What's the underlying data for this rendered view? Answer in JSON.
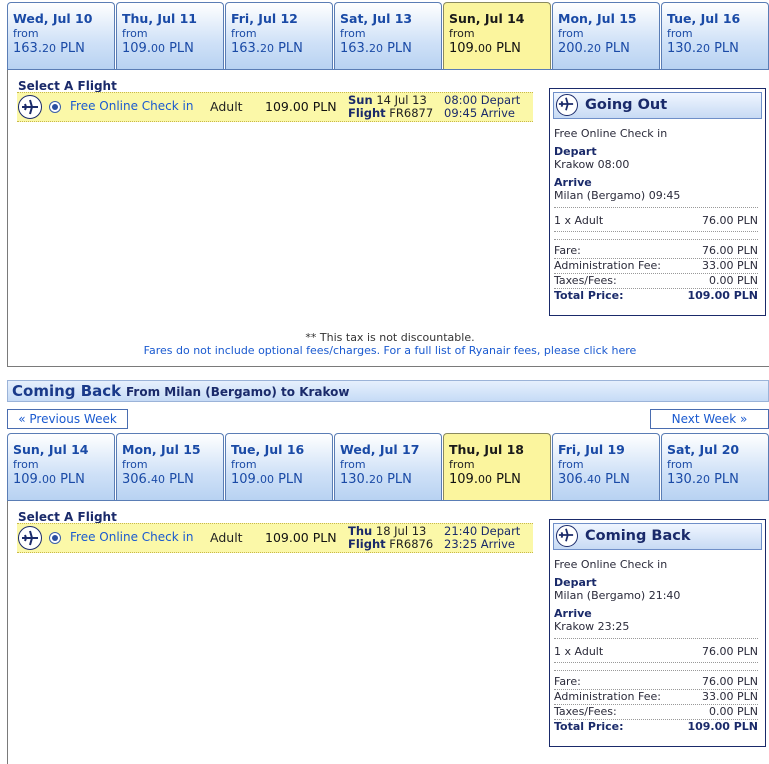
{
  "outbound": {
    "dates": [
      {
        "day": "Wed, Jul 10",
        "from": "from",
        "price_main": "163.",
        "price_dec": "20",
        "currency": " PLN"
      },
      {
        "day": "Thu, Jul 11",
        "from": "from",
        "price_main": "109.",
        "price_dec": "00",
        "currency": " PLN"
      },
      {
        "day": "Fri, Jul 12",
        "from": "from",
        "price_main": "163.",
        "price_dec": "20",
        "currency": " PLN"
      },
      {
        "day": "Sat, Jul 13",
        "from": "from",
        "price_main": "163.",
        "price_dec": "20",
        "currency": " PLN"
      },
      {
        "day": "Sun, Jul 14",
        "from": "from",
        "price_main": "109.",
        "price_dec": "00",
        "currency": " PLN"
      },
      {
        "day": "Mon, Jul 15",
        "from": "from",
        "price_main": "200.",
        "price_dec": "20",
        "currency": " PLN"
      },
      {
        "day": "Tue, Jul 16",
        "from": "from",
        "price_main": "130.",
        "price_dec": "20",
        "currency": " PLN"
      }
    ],
    "selected_index": 4,
    "select_title": "Select A Flight",
    "flight": {
      "checkin": "Free Online Check in",
      "passenger": "Adult",
      "price": "109.00 PLN",
      "date_day": "Sun",
      "date_rest": " 14 Jul 13",
      "flight_label": "Flight",
      "flight_no": " FR6877",
      "depart_time": "08:00 Depart",
      "arrive_time": "09:45 Arrive"
    },
    "summary": {
      "title": "Going Out",
      "checkin": "Free Online Check in",
      "depart_label": "Depart",
      "depart_value": "Krakow 08:00",
      "arrive_label": "Arrive",
      "arrive_value": "Milan (Bergamo) 09:45",
      "pax_label": "1 x Adult",
      "pax_value": "76.00 PLN",
      "fare_label": "Fare:",
      "fare_value": "76.00 PLN",
      "admin_label": "Administration Fee:",
      "admin_value": "33.00 PLN",
      "taxes_label": "Taxes/Fees:",
      "taxes_value": "0.00 PLN",
      "total_label": "Total Price:",
      "total_value": "109.00 PLN"
    },
    "note": "** This tax is not discountable.",
    "fees_link": "Fares do not include optional fees/charges. For a full list of Ryanair fees, please click here"
  },
  "coming_back_bar": {
    "title": "Coming Back",
    "subtitle": "From Milan (Bergamo) to Krakow"
  },
  "week_nav": {
    "prev": "« Previous Week",
    "next": "Next Week »"
  },
  "inbound": {
    "dates": [
      {
        "day": "Sun, Jul 14",
        "from": "from",
        "price_main": "109.",
        "price_dec": "00",
        "currency": " PLN"
      },
      {
        "day": "Mon, Jul 15",
        "from": "from",
        "price_main": "306.",
        "price_dec": "40",
        "currency": " PLN"
      },
      {
        "day": "Tue, Jul 16",
        "from": "from",
        "price_main": "109.",
        "price_dec": "00",
        "currency": " PLN"
      },
      {
        "day": "Wed, Jul 17",
        "from": "from",
        "price_main": "130.",
        "price_dec": "20",
        "currency": " PLN"
      },
      {
        "day": "Thu, Jul 18",
        "from": "from",
        "price_main": "109.",
        "price_dec": "00",
        "currency": " PLN"
      },
      {
        "day": "Fri, Jul 19",
        "from": "from",
        "price_main": "306.",
        "price_dec": "40",
        "currency": " PLN"
      },
      {
        "day": "Sat, Jul 20",
        "from": "from",
        "price_main": "130.",
        "price_dec": "20",
        "currency": " PLN"
      }
    ],
    "selected_index": 4,
    "select_title": "Select A Flight",
    "flight": {
      "checkin": "Free Online Check in",
      "passenger": "Adult",
      "price": "109.00 PLN",
      "date_day": "Thu",
      "date_rest": " 18 Jul 13",
      "flight_label": "Flight",
      "flight_no": " FR6876",
      "depart_time": "21:40 Depart",
      "arrive_time": "23:25 Arrive"
    },
    "summary": {
      "title": "Coming Back",
      "checkin": "Free Online Check in",
      "depart_label": "Depart",
      "depart_value": "Milan (Bergamo) 21:40",
      "arrive_label": "Arrive",
      "arrive_value": "Krakow 23:25",
      "pax_label": "1 x Adult",
      "pax_value": "76.00 PLN",
      "fare_label": "Fare:",
      "fare_value": "76.00 PLN",
      "admin_label": "Administration Fee:",
      "admin_value": "33.00 PLN",
      "taxes_label": "Taxes/Fees:",
      "taxes_value": "0.00 PLN",
      "total_label": "Total Price:",
      "total_value": "109.00 PLN"
    }
  },
  "colors": {
    "accent": "#1a2a6a",
    "link": "#1a5ad0",
    "selected_bg": "#fbf59e"
  }
}
